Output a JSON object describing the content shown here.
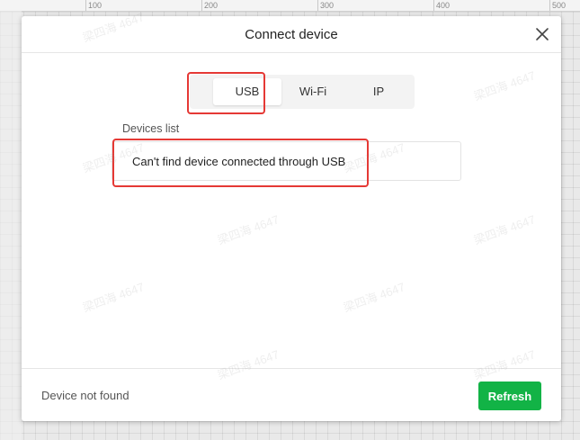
{
  "ruler": {
    "ticks": [
      "100",
      "200",
      "300",
      "400",
      "500"
    ]
  },
  "dialog": {
    "title": "Connect device",
    "close_icon": "close-icon",
    "tabs": [
      {
        "label": "USB",
        "active": true
      },
      {
        "label": "Wi-Fi",
        "active": false
      },
      {
        "label": "IP",
        "active": false
      }
    ],
    "devices_label": "Devices list",
    "devices_message": "Can't find device connected through USB",
    "footer": {
      "status": "Device not found",
      "refresh_label": "Refresh"
    }
  },
  "watermark_text": "梁四海 4647",
  "colors": {
    "accent": "#12b346",
    "highlight": "#e53935"
  }
}
